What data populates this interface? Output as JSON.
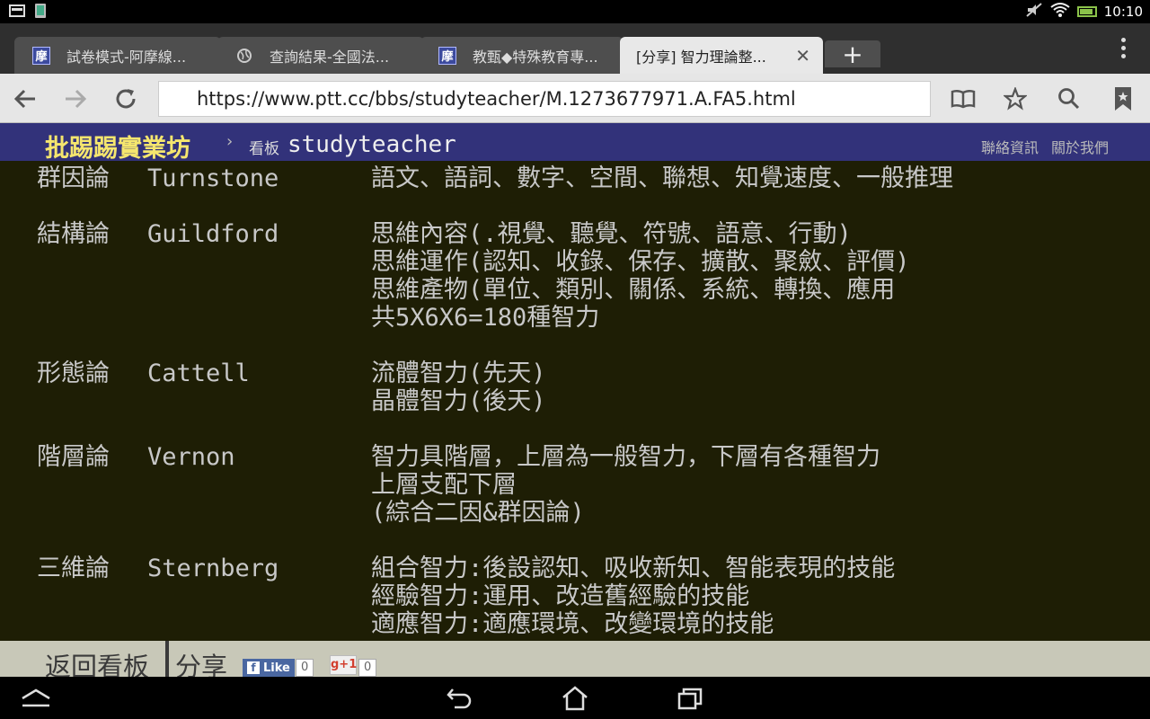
{
  "status": {
    "time": "10:10"
  },
  "tabs": [
    {
      "title": "試卷模式-阿摩線...",
      "favicon": "moe-icon",
      "fav_text": "摩"
    },
    {
      "title": "查詢結果-全國法...",
      "favicon": "globe-icon"
    },
    {
      "title": "教甄◆特殊教育專...",
      "favicon": "moe-icon",
      "fav_text": "摩"
    },
    {
      "title": "[分享] 智力理論整...",
      "active": true
    }
  ],
  "toolbar": {
    "url": "https://www.ptt.cc/bbs/studyteacher/M.1273677971.A.FA5.html"
  },
  "ptt": {
    "logo": "批踢踢實業坊",
    "breadcrumb_sep": "›",
    "board_label": "看板",
    "board_name": "studyteacher",
    "links": [
      "聯絡資訊",
      "關於我們"
    ]
  },
  "theories": [
    {
      "name": "群因論",
      "person": "Turnstone",
      "lines": [
        "語文、語詞、數字、空間、聯想、知覺速度、一般推理"
      ]
    },
    {
      "name": "結構論",
      "person": "Guildford",
      "lines": [
        "思維內容(.視覺、聽覺、符號、語意、行動)",
        "思維運作(認知、收錄、保存、擴散、聚斂、評價)",
        "思維產物(單位、類別、關係、系統、轉換、應用",
        "共5X6X6=180種智力"
      ]
    },
    {
      "name": "形態論",
      "person": "Cattell",
      "lines": [
        "流體智力(先天)",
        "晶體智力(後天)"
      ]
    },
    {
      "name": "階層論",
      "person": "Vernon",
      "lines": [
        "智力具階層，上層為一般智力，下層有各種智力",
        "上層支配下層",
        "(綜合二因&群因論)"
      ]
    },
    {
      "name": "三維論",
      "person": "Sternberg",
      "lines": [
        "組合智力:後設認知、吸收新知、智能表現的技能",
        "經驗智力:運用、改造舊經驗的技能",
        "適應智力:適應環境、改變環境的技能"
      ]
    }
  ],
  "actions": {
    "back_label": "返回看板",
    "share_label": "分享",
    "fb_like_label": "Like",
    "fb_count": "0",
    "gplus_label": "g+1",
    "gplus_count": "0"
  }
}
